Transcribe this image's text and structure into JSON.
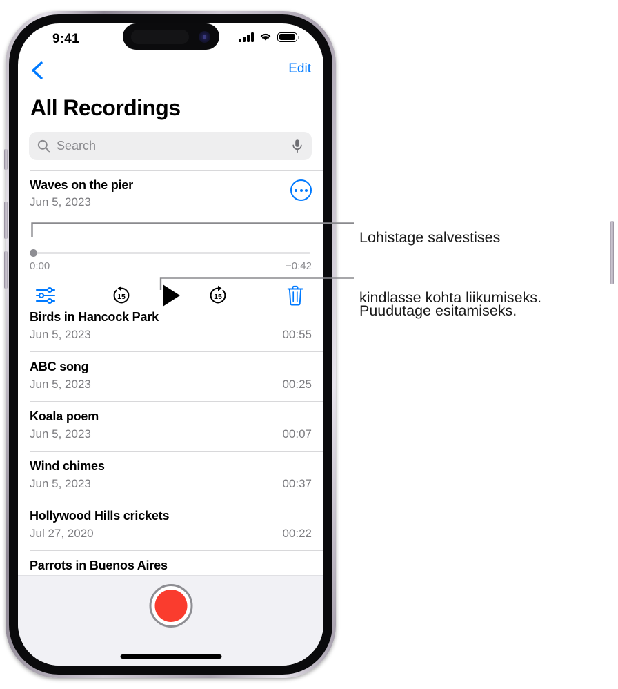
{
  "device": {
    "name": "iPhone",
    "status_bar": {
      "time": "9:41",
      "cellular_icon": "cellular-bars-icon",
      "wifi_icon": "wifi-icon",
      "battery_icon": "battery-full-icon"
    },
    "home_indicator": "home-indicator"
  },
  "nav": {
    "back_icon": "chevron-left-icon",
    "edit_label": "Edit"
  },
  "header": {
    "title": "All Recordings"
  },
  "search": {
    "placeholder": "Search",
    "value": "",
    "search_icon": "search-icon",
    "mic_icon": "microphone-icon"
  },
  "selected_recording": {
    "title": "Waves on the pier",
    "date": "Jun 5, 2023",
    "more_icon": "ellipsis-circle-icon",
    "elapsed": "0:00",
    "remaining": "−0:42",
    "progress_percent": 0,
    "controls": [
      {
        "name": "playback-options-button",
        "icon": "sliders-icon",
        "color": "#007AFF"
      },
      {
        "name": "skip-back-15-button",
        "icon": "go-back-15-icon",
        "color": "#000000",
        "label": "15"
      },
      {
        "name": "play-button",
        "icon": "play-triangle-icon",
        "color": "#000000"
      },
      {
        "name": "skip-forward-15-button",
        "icon": "go-forward-15-icon",
        "color": "#000000",
        "label": "15"
      },
      {
        "name": "delete-button",
        "icon": "trash-icon",
        "color": "#007AFF"
      }
    ]
  },
  "recordings": [
    {
      "title": "Birds in Hancock Park",
      "date": "Jun 5, 2023",
      "duration": "00:55"
    },
    {
      "title": "ABC song",
      "date": "Jun 5, 2023",
      "duration": "00:25"
    },
    {
      "title": "Koala poem",
      "date": "Jun 5, 2023",
      "duration": "00:07"
    },
    {
      "title": "Wind chimes",
      "date": "Jun 5, 2023",
      "duration": "00:37"
    },
    {
      "title": "Hollywood Hills crickets",
      "date": "Jul 27, 2020",
      "duration": "00:22"
    },
    {
      "title": "Parrots in Buenos Aires",
      "date": "",
      "duration": ""
    }
  ],
  "record_bar": {
    "record_button": "record-button"
  },
  "callouts": [
    {
      "id": "scrubber-callout",
      "line1": "Lohistage salvestises",
      "line2": "kindlasse kohta liikumiseks."
    },
    {
      "id": "play-callout",
      "line1": "Puudutage esitamiseks.",
      "line2": ""
    }
  ],
  "colors": {
    "accent_blue": "#007AFF",
    "record_red": "#FA3C2E",
    "secondary_text": "#7C7C80",
    "search_background": "#EEEEEF",
    "record_bar_background": "#F1F1F5",
    "callout_line": "#8A8A8E"
  }
}
